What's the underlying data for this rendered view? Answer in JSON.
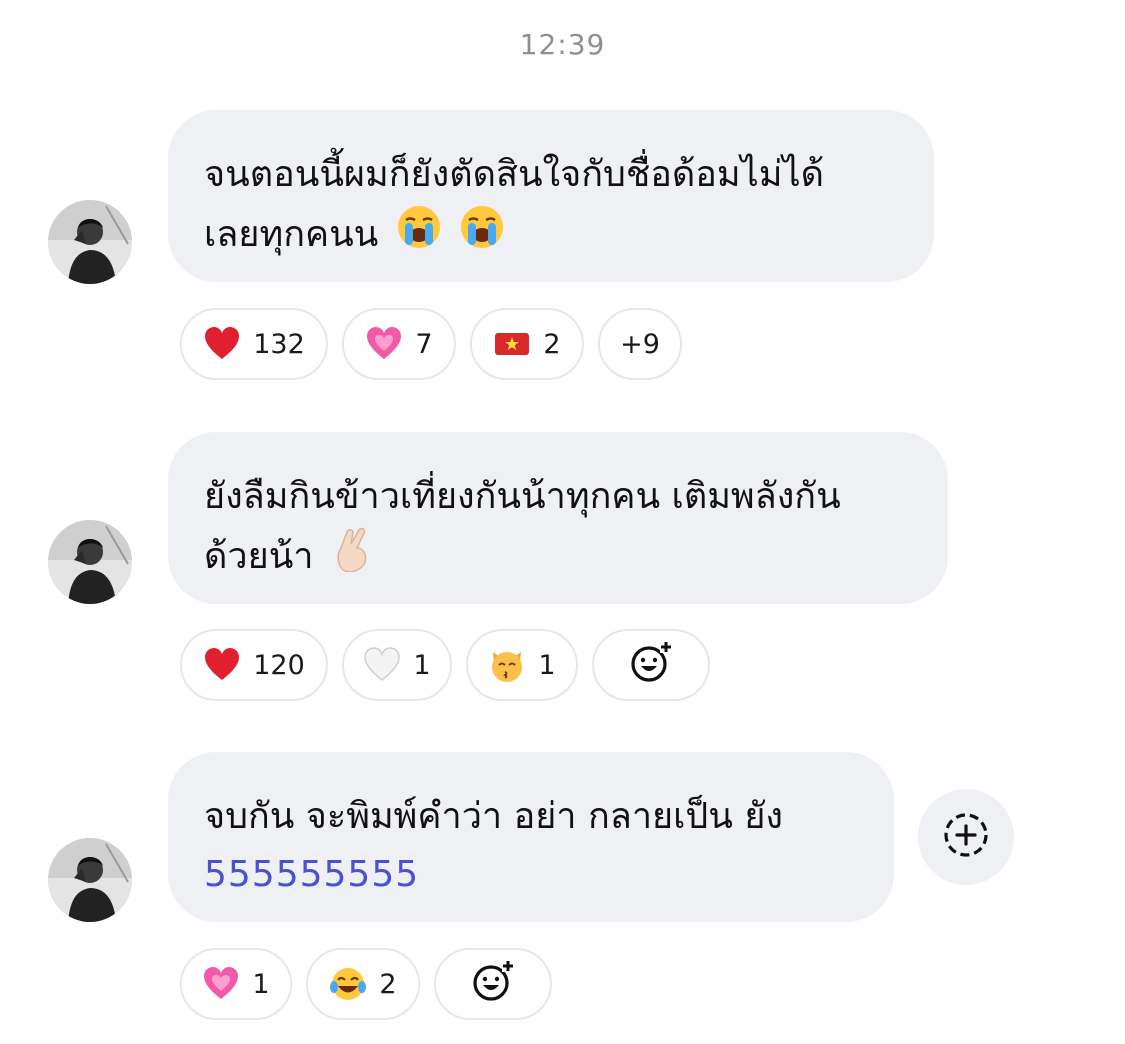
{
  "timestamp": "12:39",
  "messages": [
    {
      "lines": [
        "จนตอนนี้ผมก็ยังตัดสินใจกับชื่อด้อมไม่ได้",
        "เลยทุกคนน"
      ],
      "emoji": [
        "loudly-crying-face",
        "loudly-crying-face"
      ],
      "reactions": [
        {
          "emoji": "red-heart",
          "count": "132"
        },
        {
          "emoji": "growing-heart",
          "count": "7"
        },
        {
          "emoji": "vietnam-flag",
          "count": "2"
        },
        {
          "label": "+9"
        }
      ]
    },
    {
      "lines": [
        "ยังลืมกินข้าวเที่ยงกันน้าทุกคน เติมพลังกัน",
        "ด้วยน้า"
      ],
      "emoji": [
        "crossed-fingers-light-skin"
      ],
      "reactions": [
        {
          "emoji": "red-heart",
          "count": "120"
        },
        {
          "emoji": "white-heart",
          "count": "1"
        },
        {
          "emoji": "kissing-cat",
          "count": "1"
        },
        {
          "emoji": "add-reaction-icon"
        }
      ]
    },
    {
      "lines": [
        "จบกัน จะพิมพ์คำว่า อย่า กลายเป็น ยัง",
        "555555555"
      ],
      "reactions": [
        {
          "emoji": "growing-heart",
          "count": "1"
        },
        {
          "emoji": "tears-of-joy",
          "count": "2"
        },
        {
          "emoji": "add-reaction-icon"
        }
      ]
    }
  ],
  "colors": {
    "bubble": "#eef0f4",
    "link": "#4a4fd8",
    "timestamp": "#8e8e93",
    "pill_border": "#e6e7ea"
  }
}
